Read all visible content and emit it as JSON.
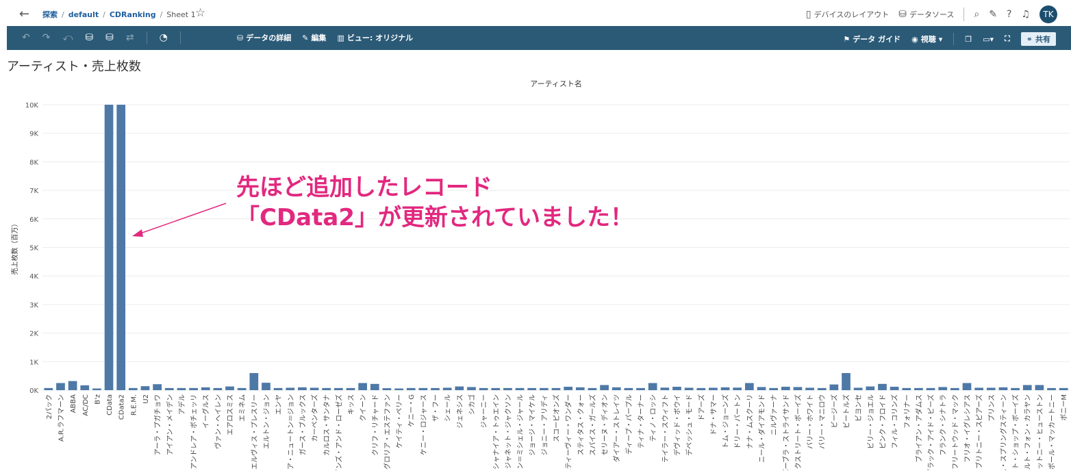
{
  "header": {
    "back_icon": "arrow-left-icon",
    "breadcrumb": [
      "探索",
      "default",
      "CDRanking",
      "Sheet 1"
    ],
    "device_layout": "デバイスのレイアウト",
    "data_source": "データソース",
    "user_initials": "TK"
  },
  "toolbar": {
    "data_details": "データの詳細",
    "edit": "編集",
    "view": "ビュー: オリジナル",
    "data_guide": "データ ガイド",
    "watch": "視聴",
    "share": "共有"
  },
  "sheet": {
    "title": "アーティスト・売上枚数"
  },
  "annotation": {
    "line1": "先ほど追加したレコード",
    "line2": "「CData2」が更新されていました！"
  },
  "colors": {
    "bar": "#4e79a7",
    "annotation": "#e2287f",
    "toolbar": "#2b5a77"
  },
  "chart_data": {
    "type": "bar",
    "title": "アーティスト名",
    "xlabel": "アーティスト名",
    "ylabel": "売上枚数（百万）",
    "ylim": [
      0,
      10000
    ],
    "yticks": [
      "0K",
      "1K",
      "2K",
      "3K",
      "4K",
      "5K",
      "6K",
      "7K",
      "8K",
      "9K",
      "10K"
    ],
    "grid": true,
    "categories": [
      "2パック",
      "A.R.ラフマーン",
      "ABBA",
      "AC/DC",
      "B'z",
      "CData",
      "CData2",
      "R.E.M.",
      "U2",
      "アーラ・プガチョワ",
      "アイアン・メイデン",
      "アデル",
      "アンドレア・ボチェッリ",
      "イーグルス",
      "ヴァン・ヘイレン",
      "エアロスミス",
      "エミネム",
      "エルヴィス・プレスリー",
      "エルトン・ジョン",
      "エンヤ",
      "オリビア・ニュートン＝ジョン",
      "ガース・ブルックス",
      "カーペンターズ",
      "カルロス・サンタナ",
      "ガンズ・アンド・ローゼズ",
      "キッス",
      "クイーン",
      "クリフ・リチャード",
      "グロリア・エステファン",
      "ケイティ・ペリー",
      "ケニー・G",
      "ケニー・ロジャース",
      "ザ・フー",
      "シェール",
      "ジェネシス",
      "シカゴ",
      "ジャーニー",
      "シャナイア・トゥエイン",
      "ジャネット・ジャクソン",
      "ジャン＝ミシェル・ジャール",
      "ジョージ・マイケル",
      "ジョニー・アリディ",
      "スコーピオンズ",
      "スティーヴィー・ワンダー",
      "スティタス・クォー",
      "スパイス・ガールズ",
      "セリーヌ・ディオン",
      "ダイアー・ストレイツ",
      "ディープ・パープル",
      "ティナ・ターナー",
      "ティノ・ロッシ",
      "テイラー・スウィフト",
      "デヴィッド・ボウイ",
      "デペッシュ・モード",
      "ドアーズ",
      "ドナ・サマー",
      "トム・ジョーンズ",
      "ドリー・パートン",
      "ナナ・ムスクーリ",
      "ニール・ダイアモンド",
      "ニルヴァーナ",
      "バーブラ・ストライサンド",
      "バックストリート・ボーイズ",
      "バリー・ホワイト",
      "バリー・マニロウ",
      "ビージーズ",
      "ビートルズ",
      "ビヨンセ",
      "ビリー・ジョエル",
      "ピンク・フロイド",
      "フィル・コリンズ",
      "フォリナー",
      "ブライアン・アダムス",
      "ブラック・アイド・ピーズ",
      "フランク・シナトラ",
      "フリートウッド・マック",
      "フリオ・イグレシアス",
      "ブリトニー・スピアーズ",
      "プリンス",
      "ブルース・スプリングスティーン",
      "ペット・ショップ・ボーイズ",
      "ヘルベルト・フォン・カラヤン",
      "ホイットニー・ヒューストン",
      "ポール・マッカートニー",
      "ボニーM"
    ],
    "values": [
      75,
      250,
      320,
      170,
      60,
      10000,
      10000,
      75,
      140,
      210,
      75,
      75,
      75,
      100,
      75,
      130,
      75,
      600,
      260,
      75,
      85,
      100,
      85,
      75,
      75,
      75,
      250,
      220,
      70,
      60,
      75,
      75,
      75,
      85,
      130,
      110,
      75,
      75,
      75,
      75,
      75,
      75,
      75,
      120,
      100,
      75,
      180,
      100,
      75,
      75,
      250,
      90,
      120,
      85,
      75,
      85,
      100,
      90,
      250,
      110,
      75,
      120,
      110,
      85,
      75,
      200,
      600,
      85,
      130,
      220,
      120,
      75,
      75,
      75,
      110,
      75,
      250,
      85,
      85,
      100,
      75,
      180,
      180,
      75,
      75
    ]
  }
}
